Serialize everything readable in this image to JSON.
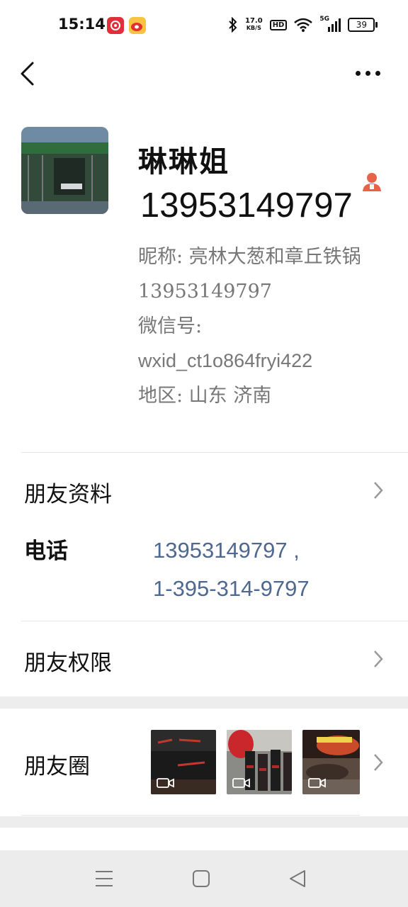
{
  "status_bar": {
    "time": "15:14",
    "speed_value": "17.0",
    "speed_unit": "KB/S",
    "hd": "HD",
    "network": "5G",
    "battery": "39"
  },
  "profile": {
    "name": "琳琳姐",
    "phone_title": "13953149797",
    "nickname": "昵称:  亮林大葱和章丘铁锅13953149797",
    "wechat_id_label": "微信号:",
    "wechat_id": "wxid_ct1o864fryi422",
    "region": "地区:  山东  济南"
  },
  "sections": {
    "friend_profile": "朋友资料",
    "phone_label": "电话",
    "phone_values": [
      "13953149797 ,",
      "1-395-314-9797"
    ],
    "friend_permissions": "朋友权限",
    "moments": "朋友圈"
  },
  "colors": {
    "link": "#4f6890",
    "accent": "#e8624a",
    "band": "#ededed"
  }
}
